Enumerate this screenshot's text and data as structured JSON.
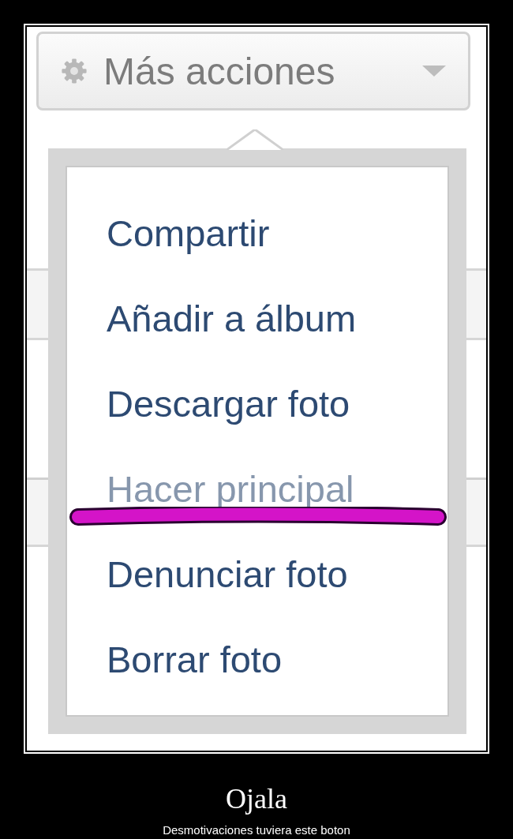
{
  "menu_button": {
    "label": "Más acciones"
  },
  "menu_items": [
    {
      "label": "Compartir",
      "disabled": false
    },
    {
      "label": "Añadir a álbum",
      "disabled": false
    },
    {
      "label": "Descargar foto",
      "disabled": false
    },
    {
      "label": "Hacer principal",
      "disabled": true
    },
    {
      "label": "Denunciar foto",
      "disabled": false
    },
    {
      "label": "Borrar foto",
      "disabled": false
    }
  ],
  "caption": {
    "title": "Ojala",
    "subtitle": "Desmotivaciones tuviera este boton"
  }
}
